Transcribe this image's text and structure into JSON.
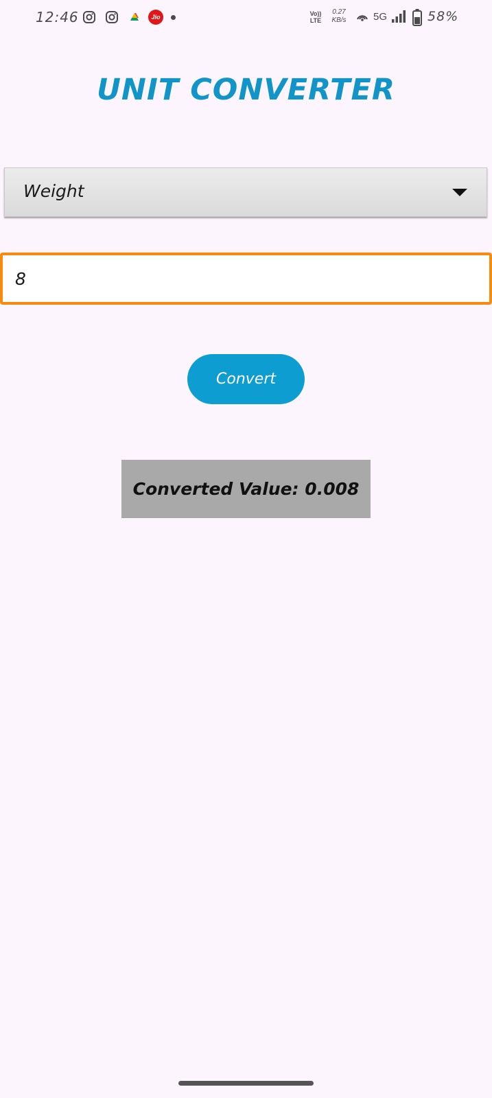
{
  "status_bar": {
    "time": "12:46",
    "notification_icons": [
      "instagram-icon",
      "instagram-icon",
      "drive-icon",
      "jio-icon",
      "more-notifications-dot"
    ],
    "jio_label": "Jio",
    "volte_top": "Vo))",
    "volte_bottom": "LTE",
    "speed_value": "0.27",
    "speed_unit": "KB/s",
    "network_type": "5G",
    "battery_percent": "58%",
    "signal_icons": [
      "hotspot-icon",
      "signal-icon",
      "battery-icon"
    ]
  },
  "app": {
    "title": "UNIT CONVERTER",
    "category_select": {
      "selected": "Weight"
    },
    "value_input": {
      "value": "8"
    },
    "convert_button": {
      "label": "Convert"
    },
    "result": {
      "text": "Converted Value: 0.008"
    }
  },
  "colors": {
    "background": "#fcf5fd",
    "accent": "#0d9dd1",
    "title": "#1195c9",
    "input_border_focus": "#f88a0f",
    "result_background": "#a9a9a9"
  }
}
